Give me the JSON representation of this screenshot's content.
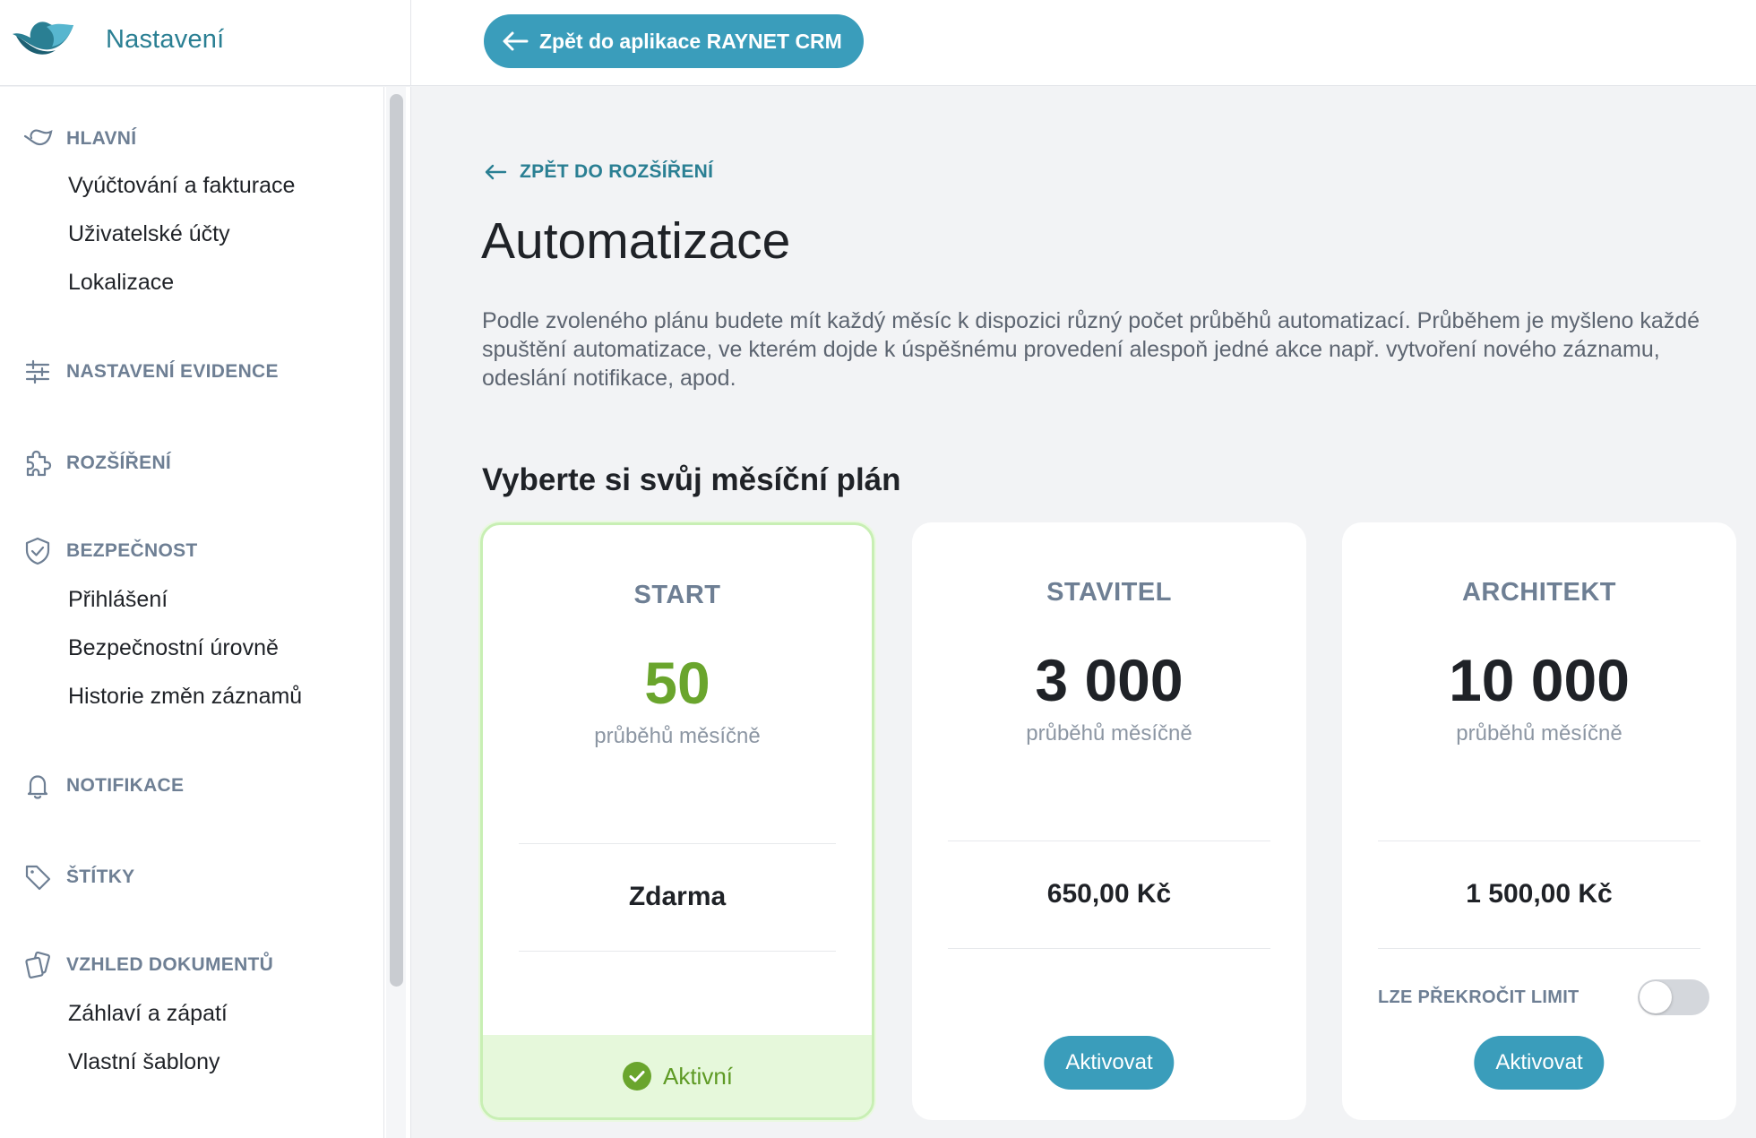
{
  "app": {
    "title": "Nastavení",
    "back_button": "Zpět do aplikace RAYNET CRM"
  },
  "sidebar": {
    "sections": [
      {
        "icon": "bird-icon",
        "label": "HLAVNÍ",
        "items": [
          "Vyúčtování a fakturace",
          "Uživatelské účty",
          "Lokalizace"
        ]
      },
      {
        "icon": "sliders-icon",
        "label": "NASTAVENÍ EVIDENCE",
        "items": []
      },
      {
        "icon": "puzzle-icon",
        "label": "ROZŠÍŘENÍ",
        "items": []
      },
      {
        "icon": "shield-icon",
        "label": "BEZPEČNOST",
        "items": [
          "Přihlášení",
          "Bezpečnostní úrovně",
          "Historie změn záznamů"
        ]
      },
      {
        "icon": "bell-icon",
        "label": "NOTIFIKACE",
        "items": []
      },
      {
        "icon": "tag-icon",
        "label": "ŠTÍTKY",
        "items": []
      },
      {
        "icon": "documents-icon",
        "label": "VZHLED DOKUMENTŮ",
        "items": [
          "Záhlaví a zápatí",
          "Vlastní šablony"
        ]
      }
    ]
  },
  "main": {
    "breadcrumb": "ZPĚT DO ROZŠÍŘENÍ",
    "title": "Automatizace",
    "description": "Podle zvoleného plánu budete mít každý měsíc k dispozici různý počet průběhů automatizací. Průběhem je myšleno každé spuštění automatizace, ve kterém dojde k úspěšnému provedení alespoň jedné akce např. vytvoření nového záznamu, odeslání notifikace, apod.",
    "plan_heading": "Vyberte si svůj měsíční plán",
    "plans": [
      {
        "name": "START",
        "runs": "50",
        "unit": "průběhů měsíčně",
        "price": "Zdarma",
        "status": "Aktivní",
        "active": true
      },
      {
        "name": "STAVITEL",
        "runs": "3 000",
        "unit": "průběhů měsíčně",
        "price": "650,00 Kč",
        "button": "Aktivovat",
        "active": false
      },
      {
        "name": "ARCHITEKT",
        "runs": "10 000",
        "unit": "průběhů měsíčně",
        "price": "1 500,00 Kč",
        "button": "Aktivovat",
        "active": false,
        "overlimit_label": "LZE PŘEKROČIT LIMIT",
        "overlimit_enabled": false
      }
    ]
  },
  "colors": {
    "accent": "#3a9dbb",
    "brand_text": "#2a7f93",
    "active_green": "#6aa52d",
    "active_bg": "#e6f8db"
  }
}
